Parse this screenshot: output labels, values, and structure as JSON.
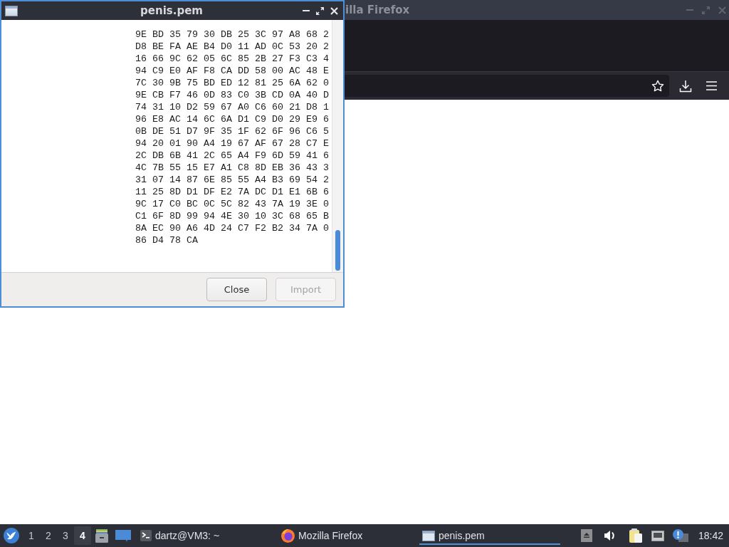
{
  "firefox_window": {
    "title": "illa Firefox"
  },
  "dialog": {
    "title": "penis.pem",
    "lines": [
      "9E BD 35 79 30 DB 25 3C 97 A8 68 2",
      "D8 BE FA AE B4 D0 11 AD 0C 53 20 2",
      "16 66 9C 62 05 6C 85 2B 27 F3 C3 4",
      "94 C9 E0 AF F8 CA DD 58 00 AC 48 E",
      "7C 30 9B 75 BD ED 12 81 25 6A 62 0",
      "9E CB F7 46 0D 83 C0 3B CD 0A 40 D",
      "74 31 10 D2 59 67 A0 C6 60 21 D8 1",
      "96 E8 AC 14 6C 6A D1 C9 D0 29 E9 6",
      "0B DE 51 D7 9F 35 1F 62 6F 96 C6 5",
      "94 20 01 90 A4 19 67 AF 67 28 C7 E",
      "2C DB 6B 41 2C 65 A4 F9 6D 59 41 6",
      "4C 7B 55 15 E7 A1 C8 8D EB 36 43 3",
      "31 07 14 87 6E 85 55 A4 B3 69 54 2",
      "11 25 8D D1 DF E2 7A DC D1 E1 6B 6",
      "9C 17 C0 BC 0C 5C 82 43 7A 19 3E 0",
      "C1 6F 8D 99 94 4E 30 10 3C 68 65 B",
      "8A EC 90 A6 4D 24 C7 F2 B2 34 7A 0",
      "86 D4 78 CA"
    ],
    "buttons": [
      {
        "label": "Close",
        "disabled": false
      },
      {
        "label": "Import",
        "disabled": true
      }
    ]
  },
  "taskbar": {
    "workspaces": [
      {
        "label": "1",
        "selected": false
      },
      {
        "label": "2",
        "selected": false
      },
      {
        "label": "3",
        "selected": false
      },
      {
        "label": "4",
        "selected": true
      }
    ],
    "tasks": [
      {
        "kind": "terminal",
        "label": "dartz@VM3: ~",
        "selected": false
      },
      {
        "kind": "browser",
        "label": "Mozilla Firefox",
        "selected": false
      },
      {
        "kind": "window",
        "label": "penis.pem",
        "selected": true
      }
    ],
    "clock": "18:42"
  }
}
